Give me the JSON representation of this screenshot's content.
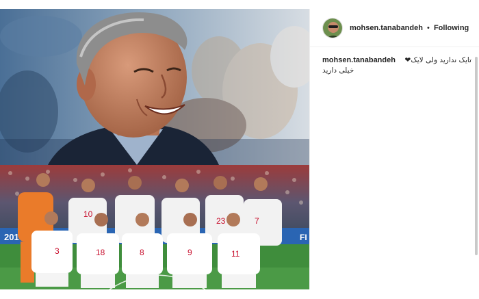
{
  "post": {
    "author": {
      "username": "mohsen.tanabandeh",
      "separator": "•",
      "follow_status": "Following"
    },
    "caption": {
      "username": "mohsen.tanabandeh",
      "line1": "تایک ندارید ولی لایک❤",
      "line2": "خیلی دارید"
    },
    "images": [
      {
        "icon": "coach-portrait-photo"
      },
      {
        "icon": "team-photo",
        "banner_text": "2018",
        "jersey_numbers": [
          "10",
          "23",
          "7",
          "3",
          "18",
          "8",
          "9",
          "11"
        ]
      }
    ]
  },
  "colors": {
    "panel_bg": "#ffffff",
    "border": "#efefef",
    "text": "#262626",
    "jersey_white": "#f2f2f2",
    "jersey_red": "#c8102e",
    "pitch_green": "#3f8d3c"
  }
}
